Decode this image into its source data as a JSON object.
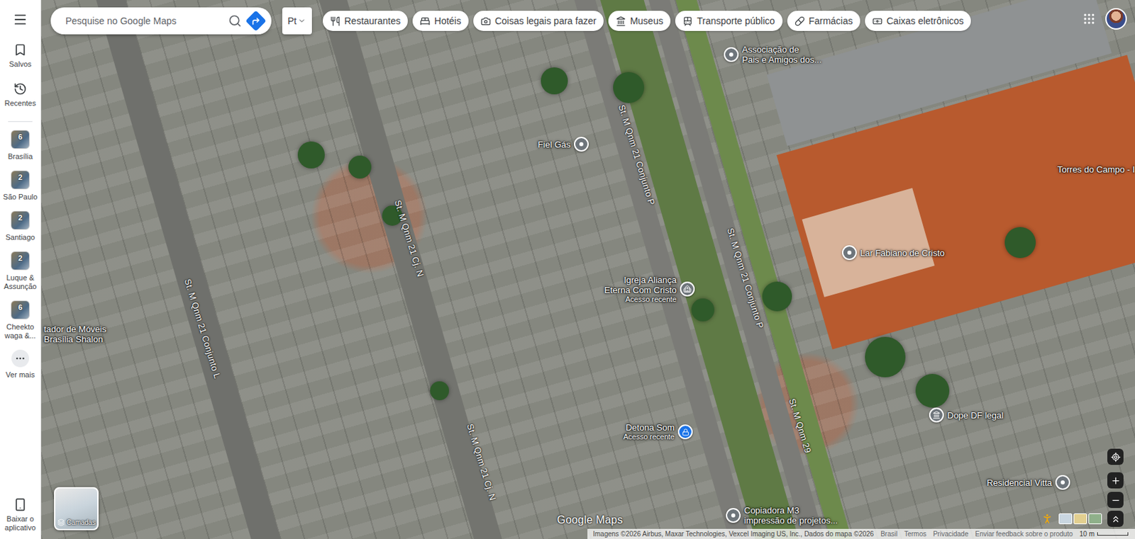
{
  "sidebar": {
    "items": [
      {
        "label": "Salvos"
      },
      {
        "label": "Recentes"
      }
    ],
    "recents": [
      {
        "label": "Brasília",
        "count": "6"
      },
      {
        "label": "São Paulo",
        "count": "2"
      },
      {
        "label": "Santiago",
        "count": "2"
      },
      {
        "label": "Luque & Assunção",
        "count": "2"
      },
      {
        "label": "Cheekto waga &...",
        "count": "6"
      }
    ],
    "more": "Ver mais",
    "download": "Baixar o aplicativo"
  },
  "search": {
    "placeholder": "Pesquise no Google Maps"
  },
  "layer_toggle": "Pt",
  "chips": [
    {
      "label": "Restaurantes"
    },
    {
      "label": "Hotéis"
    },
    {
      "label": "Coisas legais para fazer"
    },
    {
      "label": "Museus"
    },
    {
      "label": "Transporte público"
    },
    {
      "label": "Farmácias"
    },
    {
      "label": "Caixas eletrônicos"
    }
  ],
  "map": {
    "places": [
      {
        "lines": [
          "Associação de",
          "Pais e Amigos dos..."
        ],
        "kind": "pin"
      },
      {
        "lines": [
          "Fiel Gás"
        ],
        "kind": "pin"
      },
      {
        "lines": [
          "Igreja Aliança",
          "Eterna Com Cristo"
        ],
        "subtitle": "Acesso recente",
        "kind": "church"
      },
      {
        "lines": [
          "Lar Fabiano de Cristo"
        ],
        "kind": "pin"
      },
      {
        "lines": [
          "Dope DF legal"
        ],
        "kind": "museum"
      },
      {
        "lines": [
          "Residencial Vitta"
        ],
        "kind": "pin"
      },
      {
        "lines": [
          "Detona Som"
        ],
        "subtitle": "Acesso recente",
        "kind": "saved"
      },
      {
        "lines": [
          "Copiadora M3",
          "impressão de projetos..."
        ],
        "kind": "pin"
      },
      {
        "lines": [
          "Torres do Campo - I"
        ],
        "kind": "label"
      },
      {
        "lines": [
          "tador de Móveis",
          "Brasília Shalon"
        ],
        "kind": "label"
      }
    ],
    "streets": [
      "St. M Qnm 21 Conjunto L",
      "St. M Qnm 21 Cj. N",
      "St. M Qnm 21 Cj. N",
      "St. M Qnm 21 Conjunto P",
      "St. M Qnm 21 Conjunto P",
      "St. M Qnm 29"
    ]
  },
  "layers_button": "Camadas",
  "logo": "Google Maps",
  "footer": {
    "attribution": "Imagens ©2026 Airbus, Maxar Technologies, Vexcel Imaging US, Inc., Dados do mapa ©2026",
    "links": [
      "Brasil",
      "Termos",
      "Privacidade",
      "Enviar feedback sobre o produto"
    ],
    "scale": "10 m"
  }
}
